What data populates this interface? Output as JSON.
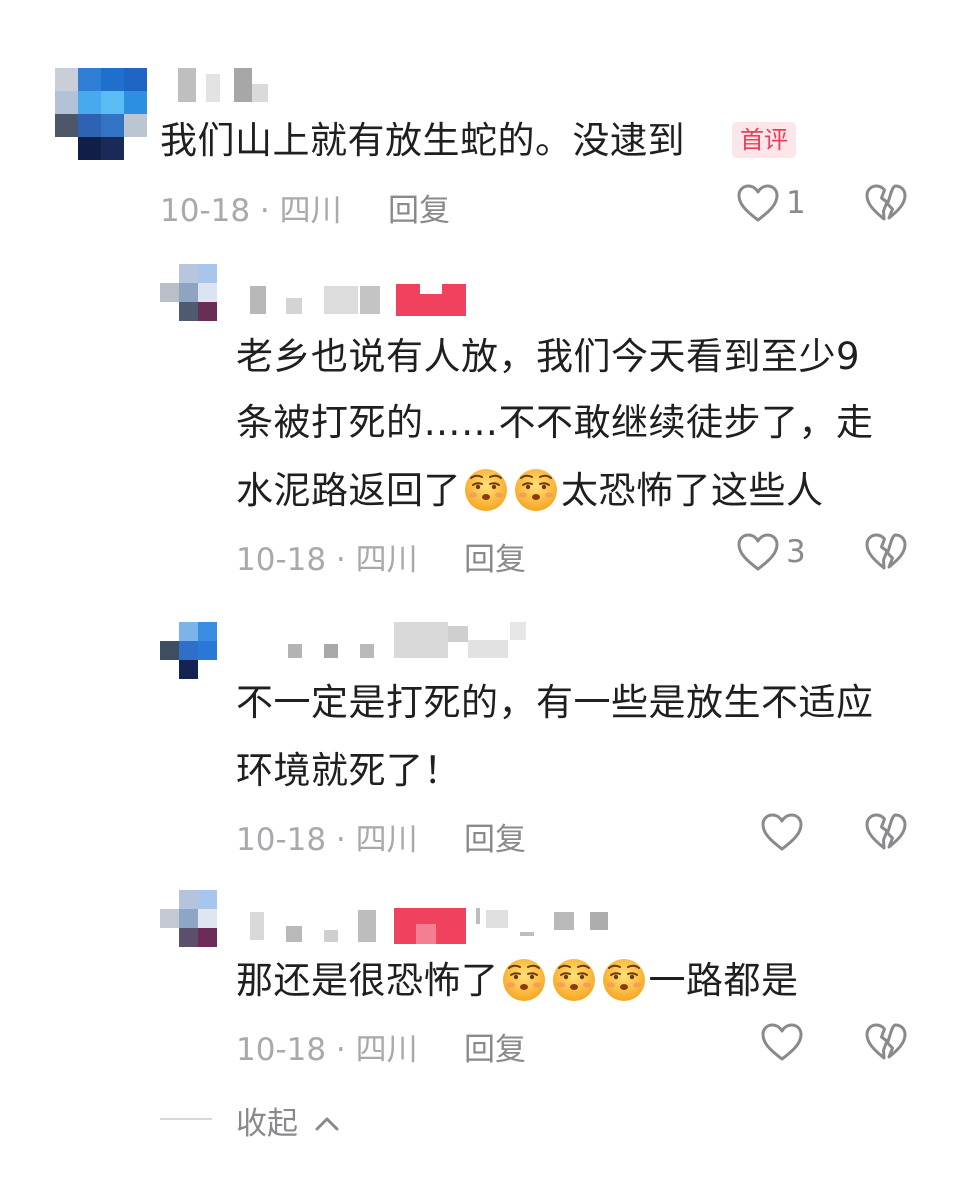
{
  "comments": [
    {
      "text": "我们山上就有放生蛇的。没逮到",
      "badge": "首评",
      "meta": "10-18 · 四川",
      "reply_label": "回复",
      "likes": "1"
    },
    {
      "lines": [
        "老乡也说有人放，我们今天看到至少9",
        "条被打死的……不不敢继续徒步了，走"
      ],
      "line3_a": "水泥路返回了",
      "line3_b": "太恐怖了这些人",
      "meta": "10-18 · 四川",
      "reply_label": "回复",
      "likes": "3"
    },
    {
      "lines": [
        "不一定是打死的，有一些是放生不适应",
        "环境就死了！"
      ],
      "meta": "10-18 · 四川",
      "reply_label": "回复"
    },
    {
      "line_a": "那还是很恐怖了",
      "line_b": "一路都是",
      "meta": "10-18 · 四川",
      "reply_label": "回复"
    }
  ],
  "collapse_label": "收起",
  "icons": {
    "like": "heart-outline-icon",
    "dislike": "broken-heart-icon",
    "emoji": "unamused-face-emoji",
    "collapse": "chevron-up-icon"
  },
  "colors": {
    "badge_text": "#ee3d5c",
    "badge_bg": "#fde6ea",
    "meta": "#a9a9ad",
    "icon": "#8a8a8e"
  }
}
